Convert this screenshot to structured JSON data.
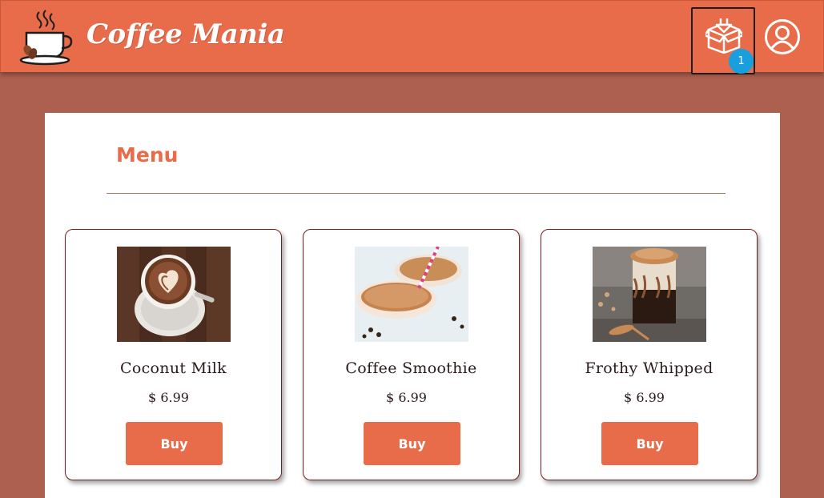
{
  "header": {
    "brand": "Coffee Mania",
    "cart_count": "1"
  },
  "menu": {
    "title": "Menu"
  },
  "products": [
    {
      "name": "Coconut Milk",
      "price": "$ 6.99",
      "buy_label": "Buy"
    },
    {
      "name": "Coffee Smoothie",
      "price": "$ 6.99",
      "buy_label": "Buy"
    },
    {
      "name": "Frothy Whipped",
      "price": "$ 6.99",
      "buy_label": "Buy"
    }
  ],
  "colors": {
    "accent": "#e96c4a",
    "background": "#ad604f",
    "badge": "#1a9fde",
    "card_border": "#7a1f1f"
  },
  "icons": [
    "coffee-cup-logo-icon",
    "box-download-icon",
    "user-icon"
  ]
}
